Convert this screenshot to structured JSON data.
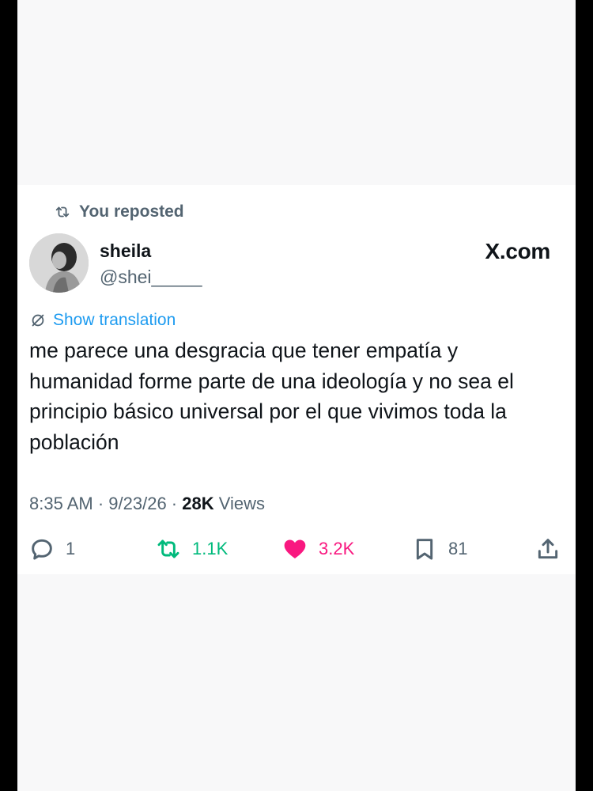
{
  "repost": {
    "label": "You reposted",
    "icon": "repost-icon"
  },
  "author": {
    "display_name": "sheila",
    "handle": "@shei_____"
  },
  "brand": "X.com",
  "translation": {
    "label": "Show translation",
    "icon": "translate-icon"
  },
  "tweet": {
    "text": "me parece una desgracia que tener empatía y humanidad forme parte de una ideología y no sea el principio básico universal por el que vivimos toda la población"
  },
  "meta": {
    "time": "8:35 AM",
    "sep1": " · ",
    "date": "9/23/26",
    "sep2": " · ",
    "views_count": "28K",
    "views_label": " Views"
  },
  "actions": {
    "reply": {
      "count": "1",
      "icon": "reply-icon"
    },
    "repost": {
      "count": "1.1K",
      "icon": "repost-icon",
      "color": "#00ba7c"
    },
    "like": {
      "count": "3.2K",
      "icon": "heart-icon",
      "color": "#f91880"
    },
    "bookmark": {
      "count": "81",
      "icon": "bookmark-icon"
    },
    "share": {
      "icon": "share-icon"
    }
  },
  "colors": {
    "accent": "#1d9bf0",
    "text": "#0f1419",
    "secondary": "#536471"
  }
}
